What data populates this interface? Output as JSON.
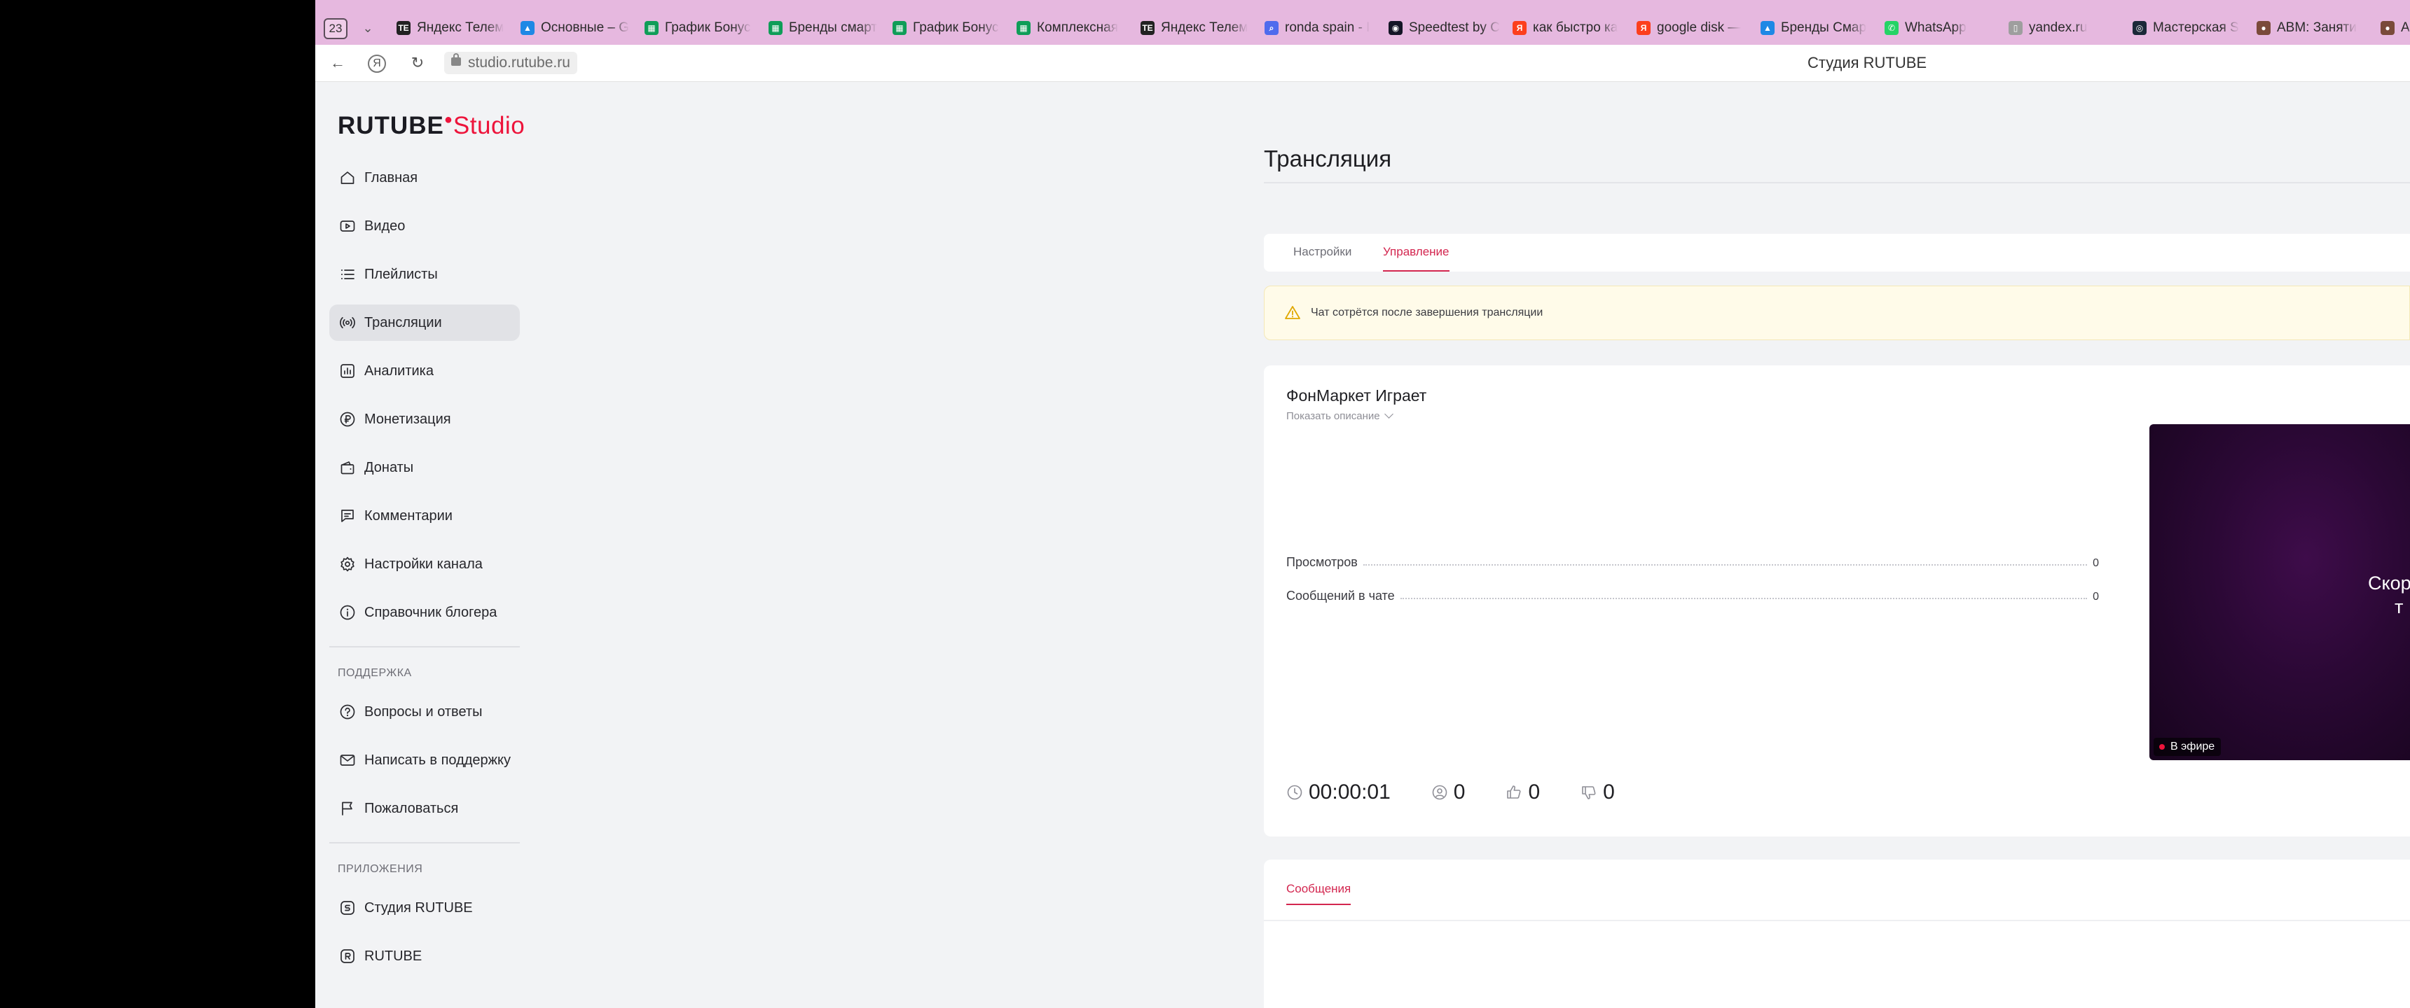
{
  "browser": {
    "tab_count": "23",
    "tabs": [
      {
        "title": "Яндекс Телем",
        "color": "#222222",
        "icon": "app-icon"
      },
      {
        "title": "Основные – G",
        "color": "#1e88e5",
        "icon": "drive-icon"
      },
      {
        "title": "График Бонус",
        "color": "#0f9d58",
        "icon": "sheets-icon"
      },
      {
        "title": "Бренды смарт",
        "color": "#0f9d58",
        "icon": "sheets-icon"
      },
      {
        "title": "График Бонус",
        "color": "#0f9d58",
        "icon": "sheets-icon"
      },
      {
        "title": "Комплексная",
        "color": "#0f9d58",
        "icon": "sheets-icon"
      },
      {
        "title": "Яндекс Телем",
        "color": "#222222",
        "icon": "app-icon"
      },
      {
        "title": "ronda spain - I",
        "color": "#4f6bed",
        "icon": "search-icon"
      },
      {
        "title": "Speedtest by C",
        "color": "#141526",
        "icon": "speedtest-icon"
      },
      {
        "title": "как быстро ка",
        "color": "#fc3f1d",
        "icon": "yandex-icon"
      },
      {
        "title": "google disk —",
        "color": "#fc3f1d",
        "icon": "yandex-icon"
      },
      {
        "title": "Бренды Смар",
        "color": "#1e88e5",
        "icon": "drive-icon"
      },
      {
        "title": "WhatsApp",
        "color": "#25d366",
        "icon": "whatsapp-icon"
      },
      {
        "title": "yandex.ru",
        "color": "#9e9e9e",
        "icon": "page-icon"
      },
      {
        "title": "Мастерская S",
        "color": "#1b2838",
        "icon": "steam-icon"
      },
      {
        "title": "АВМ: Заняти",
        "color": "#7a4a3a",
        "icon": "avatar-icon"
      },
      {
        "title": "А",
        "color": "#7a4a3a",
        "icon": "avatar-icon"
      }
    ],
    "url": "studio.rutube.ru",
    "page_title": "Студия RUTUBE"
  },
  "sidebar": {
    "logo_main": "RUTUBE",
    "logo_sub": "Studio",
    "items": [
      {
        "label": "Главная",
        "icon": "home-icon",
        "active": false
      },
      {
        "label": "Видео",
        "icon": "video-icon",
        "active": false
      },
      {
        "label": "Плейлисты",
        "icon": "playlist-icon",
        "active": false
      },
      {
        "label": "Трансляции",
        "icon": "broadcast-icon",
        "active": true
      },
      {
        "label": "Аналитика",
        "icon": "analytics-icon",
        "active": false
      },
      {
        "label": "Монетизация",
        "icon": "ruble-icon",
        "active": false
      },
      {
        "label": "Донаты",
        "icon": "wallet-icon",
        "active": false
      },
      {
        "label": "Комментарии",
        "icon": "comment-icon",
        "active": false
      },
      {
        "label": "Настройки канала",
        "icon": "gear-icon",
        "active": false
      },
      {
        "label": "Справочник блогера",
        "icon": "info-icon",
        "active": false
      }
    ],
    "support_title": "Поддержка",
    "support_items": [
      {
        "label": "Вопросы и ответы",
        "icon": "question-icon"
      },
      {
        "label": "Написать в поддержку",
        "icon": "mail-icon"
      },
      {
        "label": "Пожаловаться",
        "icon": "flag-icon"
      }
    ],
    "apps_title": "Приложения",
    "apps_items": [
      {
        "label": "Студия RUTUBE",
        "icon": "studio-app-icon"
      },
      {
        "label": "RUTUBE",
        "icon": "rutube-app-icon"
      }
    ]
  },
  "main": {
    "title": "Трансляция",
    "tabs": [
      {
        "label": "Настройки",
        "active": false
      },
      {
        "label": "Управление",
        "active": true
      }
    ],
    "alert_text": "Чат сотрётся после завершения трансляции",
    "stream": {
      "title": "ФонМаркет Играет",
      "show_description": "Показать описание",
      "stats": [
        {
          "label": "Просмотров",
          "value": "0"
        },
        {
          "label": "Сообщений в чате",
          "value": "0"
        }
      ],
      "duration": "00:00:01",
      "viewers": "0",
      "likes": "0",
      "dislikes": "0",
      "preview_text_line1": "Скор",
      "preview_text_line2": "т",
      "live_badge": "В эфире"
    },
    "messages_tab": "Сообщения"
  },
  "colors": {
    "accent": "#d3264f",
    "brand_red": "#ed143b",
    "tabbar": "#e6b8df"
  }
}
